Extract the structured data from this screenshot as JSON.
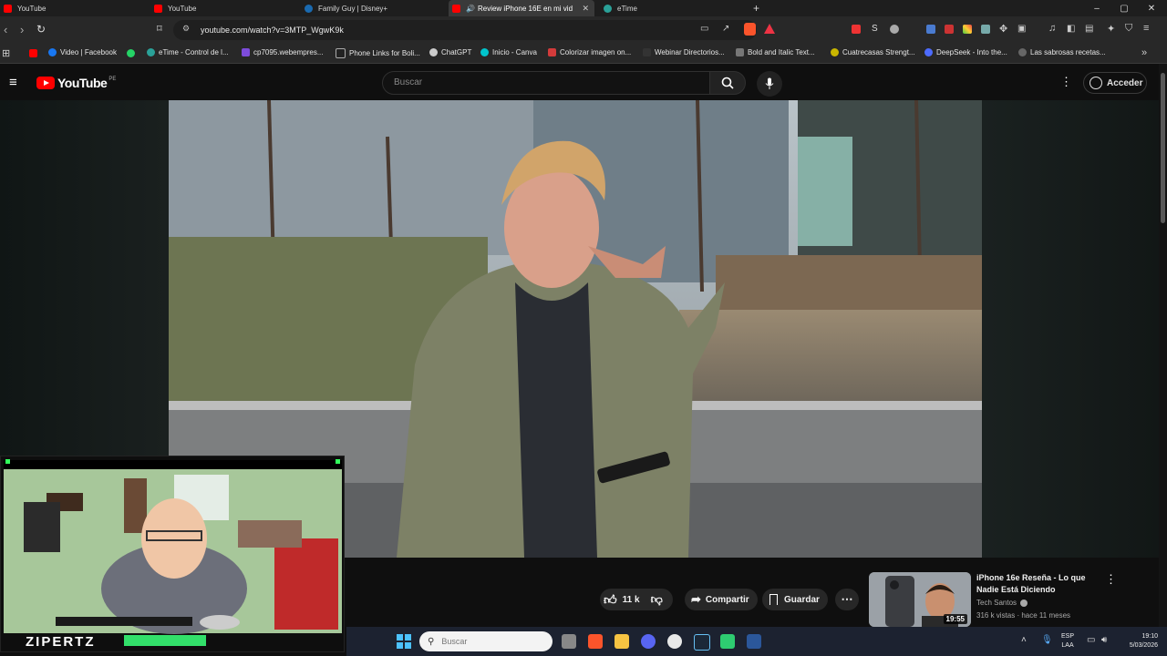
{
  "tabs": [
    {
      "label": "YouTube",
      "icon": "youtube-icon"
    },
    {
      "label": "YouTube",
      "icon": "youtube-icon"
    },
    {
      "label": "Family Guy | Disney+",
      "icon": "disney-icon"
    },
    {
      "label": "Review iPhone 16E en mi vid",
      "icon": "youtube-icon",
      "active": true
    },
    {
      "label": "eTime",
      "icon": "etime-icon"
    }
  ],
  "new_tab": "+",
  "window_controls": [
    "–",
    "▢",
    "✕"
  ],
  "address": {
    "url": "youtube.com/watch?v=3MTP_WgwK9k"
  },
  "bookmarks": [
    {
      "label": "Video | Facebook",
      "color": "#1877f2"
    },
    {
      "label": "eTime - Control de l...",
      "color": "#2aa198"
    },
    {
      "label": "cp7095.webempres...",
      "color": "#7d4cdb"
    },
    {
      "label": "Phone Links for Boli...",
      "color": "#222222"
    },
    {
      "label": "ChatGPT",
      "color": "#444444"
    },
    {
      "label": "Inicio - Canva",
      "color": "#00c4cc"
    },
    {
      "label": "Colorizar imagen on...",
      "color": "#d33b3b"
    },
    {
      "label": "Webinar Directorios...",
      "color": "#333333"
    },
    {
      "label": "Bold and Italic Text...",
      "color": "#555555"
    },
    {
      "label": "Cuatrecasas Strengt...",
      "color": "#c9b600"
    },
    {
      "label": "DeepSeek - Into the...",
      "color": "#4d6bfe"
    },
    {
      "label": "Las sabrosas recetas...",
      "color": "#666666"
    }
  ],
  "youtube": {
    "logo_text": "YouTube",
    "country": "PE",
    "search_placeholder": "Buscar",
    "signin_label": "Acceder"
  },
  "actions": {
    "likes": "11 k",
    "share": "Compartir",
    "save": "Guardar"
  },
  "recommended": {
    "title": "iPhone 16e Reseña - Lo que Nadie Está Diciendo",
    "channel": "Tech Santos",
    "meta": "316 k vistas · hace 11 meses",
    "duration": "19:55"
  },
  "overlay": {
    "name": "ZIPERTZ"
  },
  "taskbar": {
    "search_placeholder": "Buscar",
    "lang": "ESP",
    "region": "LAA",
    "time": "19:10",
    "date": "5/03/2026"
  },
  "colors": {
    "accent": "#ff0000",
    "background": "#0f0f0f"
  }
}
